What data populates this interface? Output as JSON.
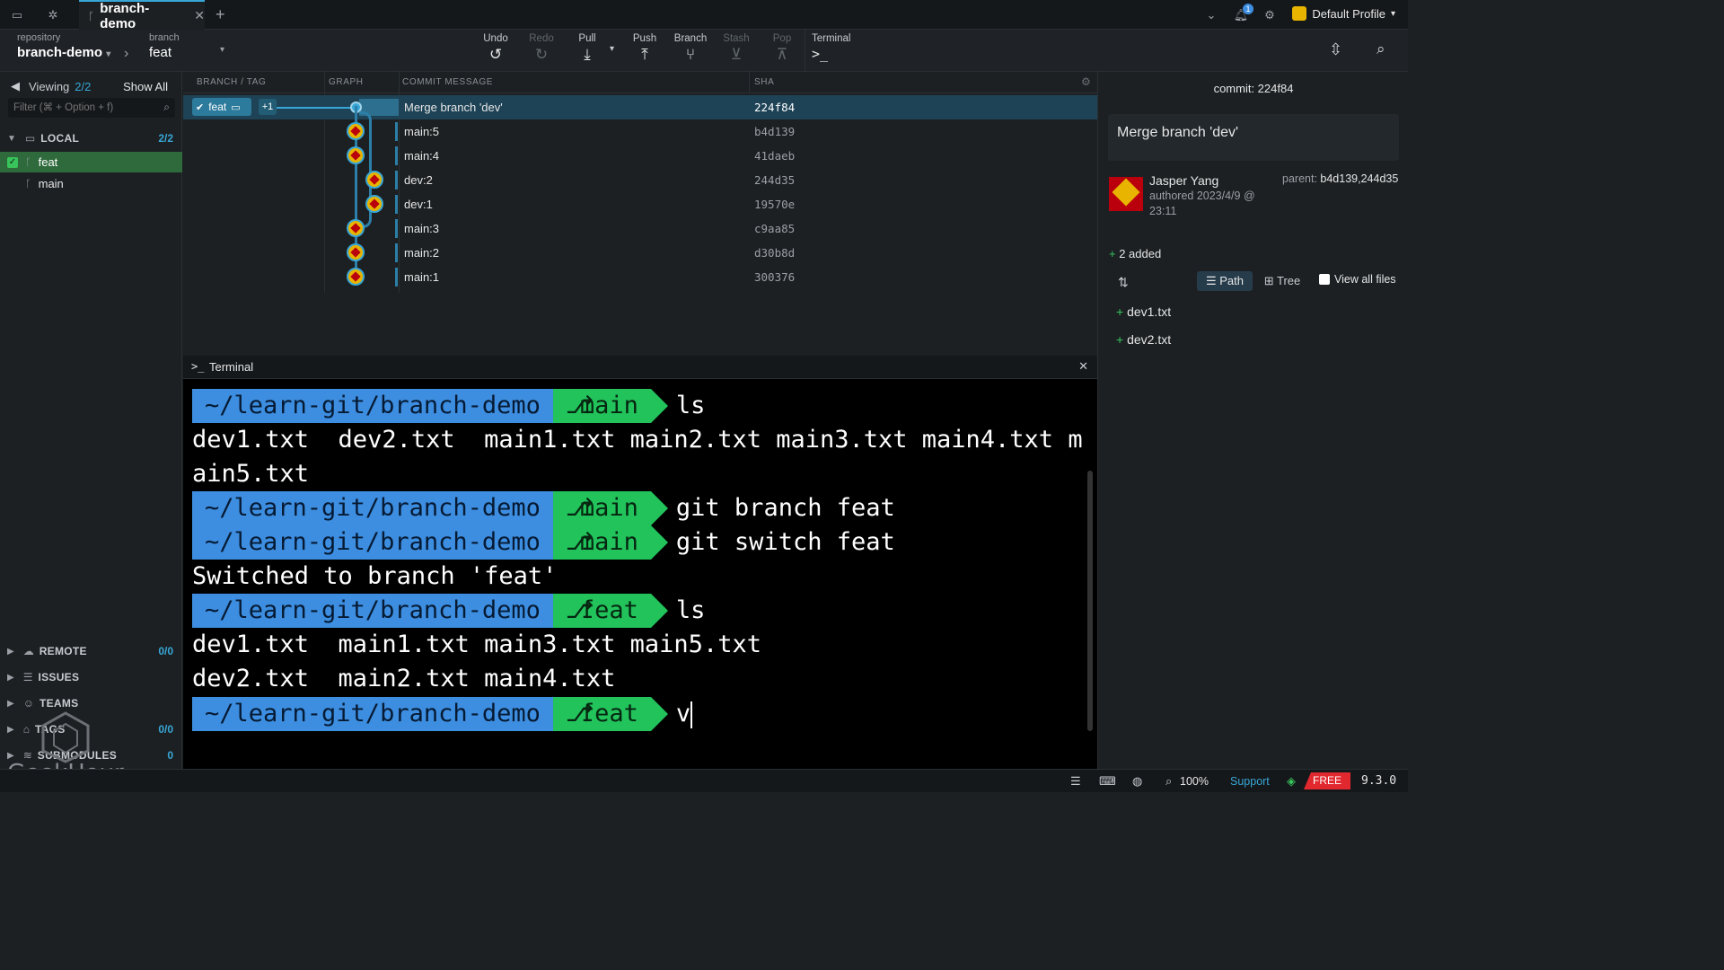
{
  "titlebar": {
    "tab_title": "branch-demo",
    "profile_label": "Default Profile",
    "notification_count": "1"
  },
  "toolbar": {
    "repository_label": "repository",
    "repository_name": "branch-demo",
    "branch_label": "branch",
    "branch_name": "feat",
    "undo": "Undo",
    "redo": "Redo",
    "pull": "Pull",
    "push": "Push",
    "branch": "Branch",
    "stash": "Stash",
    "pop": "Pop",
    "terminal": "Terminal"
  },
  "left": {
    "viewing_label": "Viewing",
    "viewing_count": "2/2",
    "show_all": "Show All",
    "filter_placeholder": "Filter (⌘ + Option + f)",
    "local_label": "LOCAL",
    "local_count": "2/2",
    "branches": [
      "feat",
      "main"
    ],
    "remote_label": "REMOTE",
    "remote_count": "0/0",
    "issues_label": "ISSUES",
    "teams_label": "TEAMS",
    "tags_label": "TAGS",
    "tags_count": "0/0",
    "submodules_label": "SUBMODULES",
    "submodules_count": "0"
  },
  "graph": {
    "col_branch": "BRANCH / TAG",
    "col_graph": "GRAPH",
    "col_message": "COMMIT MESSAGE",
    "col_sha": "SHA",
    "head_branch": "feat",
    "head_extra": "+1",
    "commits": [
      {
        "message": "Merge branch 'dev'",
        "sha": "224f84"
      },
      {
        "message": "main:5",
        "sha": "b4d139"
      },
      {
        "message": "main:4",
        "sha": "41daeb"
      },
      {
        "message": "dev:2",
        "sha": "244d35"
      },
      {
        "message": "dev:1",
        "sha": "19570e"
      },
      {
        "message": "main:3",
        "sha": "c9aa85"
      },
      {
        "message": "main:2",
        "sha": "d30b8d"
      },
      {
        "message": "main:1",
        "sha": "300376"
      }
    ]
  },
  "terminal": {
    "title": "Terminal",
    "path": "~/learn-git/branch-demo",
    "lines": [
      {
        "type": "prompt",
        "branch": "main",
        "cmd": "ls"
      },
      {
        "type": "out",
        "text": "dev1.txt  dev2.txt  main1.txt main2.txt main3.txt main4.txt m"
      },
      {
        "type": "out",
        "text": "ain5.txt"
      },
      {
        "type": "prompt",
        "branch": "main",
        "cmd": "git branch feat"
      },
      {
        "type": "prompt",
        "branch": "main",
        "cmd": "git switch feat"
      },
      {
        "type": "out",
        "text": "Switched to branch 'feat'"
      },
      {
        "type": "prompt",
        "branch": "feat",
        "cmd": "ls"
      },
      {
        "type": "out",
        "text": "dev1.txt  main1.txt main3.txt main5.txt"
      },
      {
        "type": "out",
        "text": "dev2.txt  main2.txt main4.txt"
      },
      {
        "type": "prompt",
        "branch": "feat",
        "cmd": "v"
      }
    ]
  },
  "right": {
    "commit_label": "commit: 224f84",
    "message": "Merge branch 'dev'",
    "author": "Jasper Yang",
    "authored": "authored 2023/4/9 @",
    "authored_time": "23:11",
    "parent_label": "parent:",
    "parent_value": "b4d139,244d35",
    "added_label": "2 added",
    "path_btn": "Path",
    "tree_btn": "Tree",
    "view_all": "View all files",
    "files": [
      "dev1.txt",
      "dev2.txt"
    ]
  },
  "status": {
    "zoom": "100%",
    "support": "Support",
    "free": "FREE",
    "version": "9.3.0"
  },
  "watermark": "GeekHour",
  "colors": {
    "accent": "#38a6d6",
    "prompt_path": "#3d8ee0",
    "prompt_branch": "#22c35b",
    "selected_row": "#1e4356",
    "free_badge": "#e0282e"
  }
}
